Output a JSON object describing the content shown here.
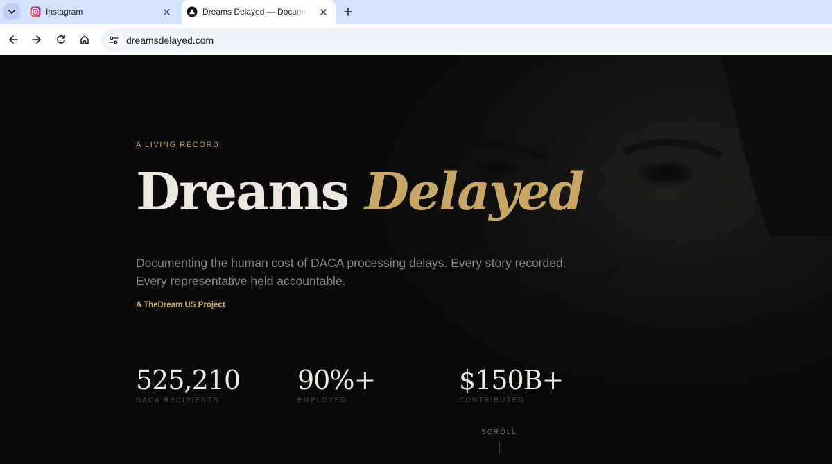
{
  "browser": {
    "tabs": [
      {
        "title": "Instagram",
        "favicon": "instagram-icon",
        "active": false
      },
      {
        "title": "Dreams Delayed — Documenting",
        "favicon": "triangle-logo-icon",
        "active": true
      }
    ],
    "address_bar": {
      "url": "dreamsdelayed.com"
    }
  },
  "hero": {
    "eyebrow": "A LIVING RECORD",
    "title_main": "Dreams ",
    "title_accent": "Delayed",
    "subtitle": "Documenting the human cost of DACA processing delays. Every story recorded. Every representative held accountable.",
    "byline": "A TheDream.US Project"
  },
  "stats": [
    {
      "value": "525,210",
      "label": "DACA RECIPIENTS"
    },
    {
      "value": "90%+",
      "label": "EMPLOYED"
    },
    {
      "value": "$150B+",
      "label": "CONTRIBUTED"
    }
  ],
  "scroll_hint": "SCROLL",
  "colors": {
    "background": "#0a0a0a",
    "accent_gold": "#c9a664",
    "title_text": "#ece8e0",
    "subtitle_text": "#8a8883",
    "tabstrip": "#d3e3fd"
  }
}
